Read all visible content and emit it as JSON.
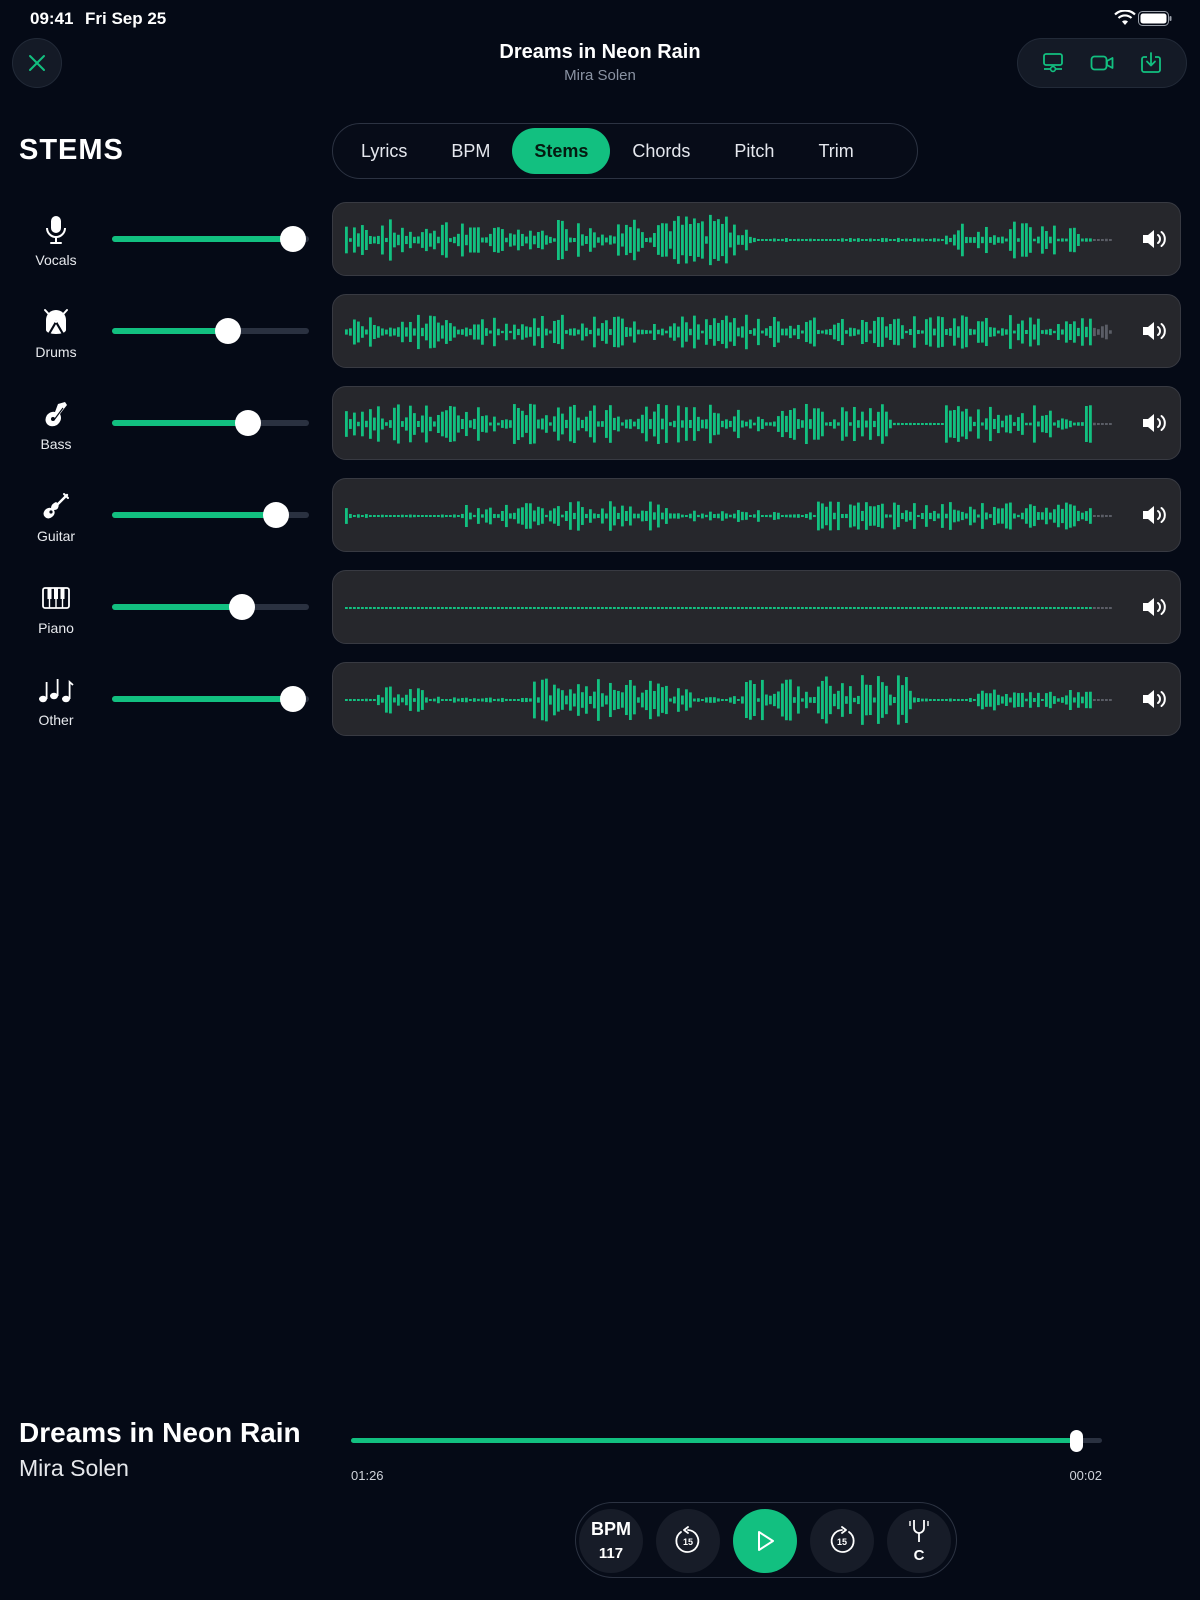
{
  "status_bar": {
    "time": "09:41",
    "date": "Fri Sep 25"
  },
  "header": {
    "title": "Dreams in Neon Rain",
    "artist": "Mira Solen",
    "actions": [
      "mixer-icon",
      "video-icon",
      "download-icon"
    ]
  },
  "section_title": "STEMS",
  "tabs": [
    {
      "label": "Lyrics",
      "active": false
    },
    {
      "label": "BPM",
      "active": false
    },
    {
      "label": "Stems",
      "active": true
    },
    {
      "label": "Chords",
      "active": false
    },
    {
      "label": "Pitch",
      "active": false
    },
    {
      "label": "Trim",
      "active": false
    }
  ],
  "stems": [
    {
      "name": "Vocals",
      "icon": "microphone-icon",
      "volume": 0.92
    },
    {
      "name": "Drums",
      "icon": "drum-icon",
      "volume": 0.59
    },
    {
      "name": "Bass",
      "icon": "bass-guitar-icon",
      "volume": 0.69
    },
    {
      "name": "Guitar",
      "icon": "guitar-icon",
      "volume": 0.83
    },
    {
      "name": "Piano",
      "icon": "piano-icon",
      "volume": 0.66
    },
    {
      "name": "Other",
      "icon": "music-notes-icon",
      "volume": 0.92
    }
  ],
  "now_playing": {
    "title": "Dreams in Neon Rain",
    "artist": "Mira Solen",
    "elapsed": "01:26",
    "remaining": "00:02",
    "progress": 0.965
  },
  "transport": {
    "bpm_label": "BPM",
    "bpm_value": "117",
    "skip_back": "15",
    "skip_forward": "15",
    "key": "C"
  },
  "colors": {
    "accent": "#12c080",
    "background": "#050a16",
    "panel": "#26272c"
  }
}
